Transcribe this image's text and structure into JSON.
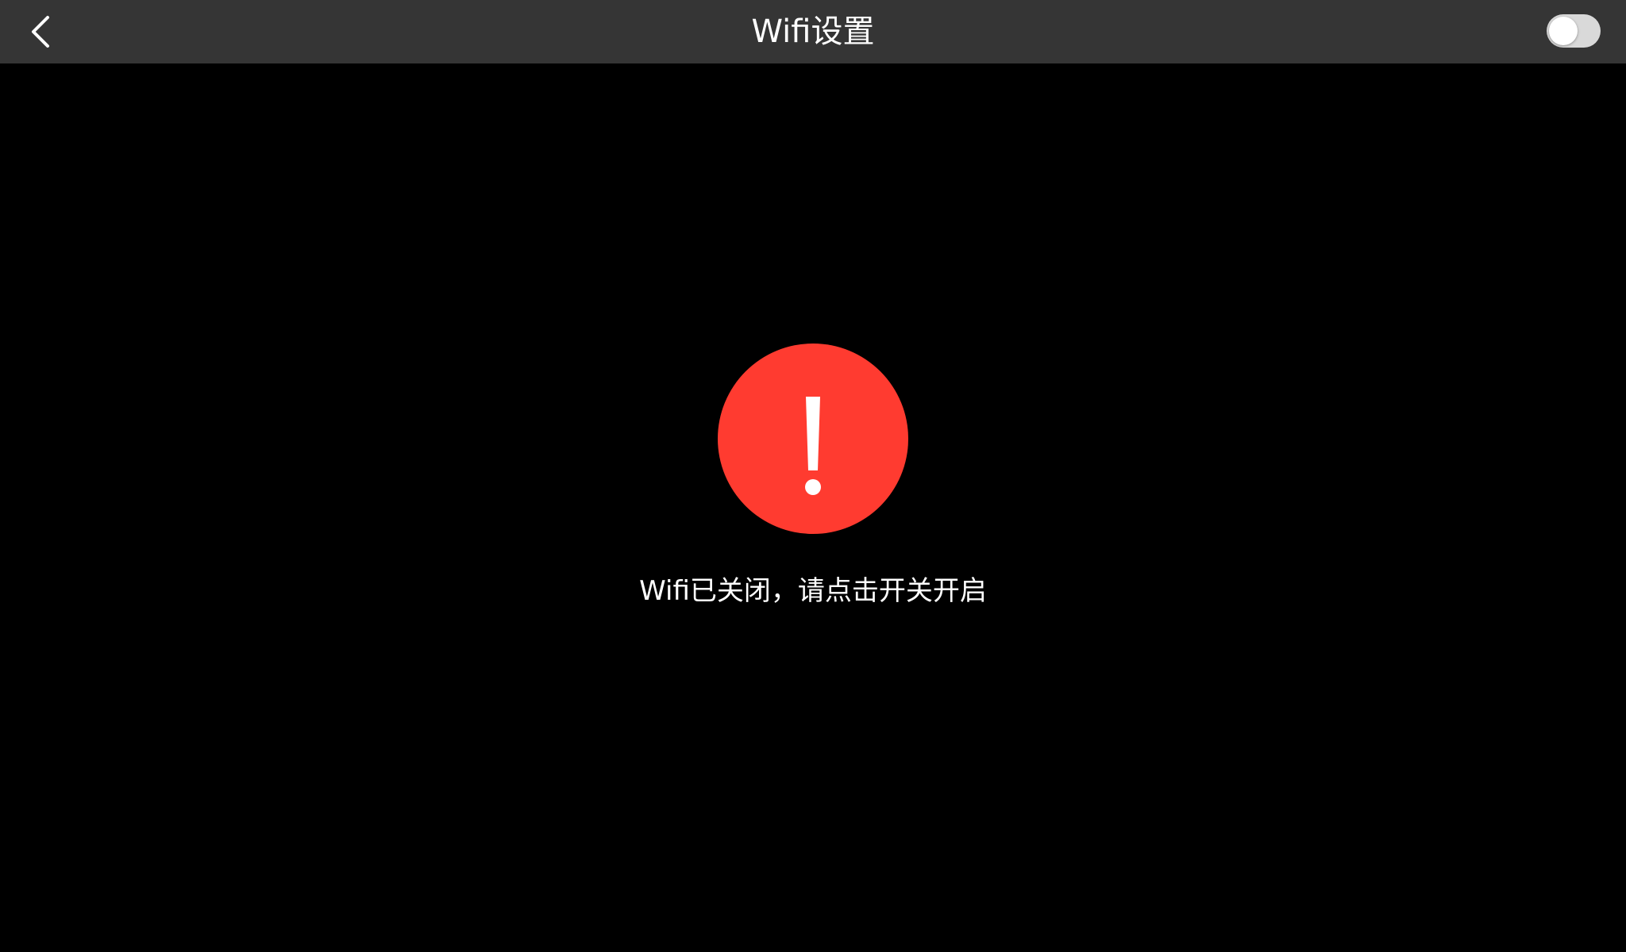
{
  "navbar": {
    "title": "Wifi设置",
    "back_icon": "chevron-left-icon",
    "wifi_toggle": {
      "state": "off"
    }
  },
  "status": {
    "icon": "exclamation-icon",
    "icon_color": "#ff3b30",
    "message": "Wifi已关闭，请点击开关开启"
  },
  "colors": {
    "navbar_bg": "#353535",
    "background": "#000000",
    "alert": "#ff3b30"
  }
}
